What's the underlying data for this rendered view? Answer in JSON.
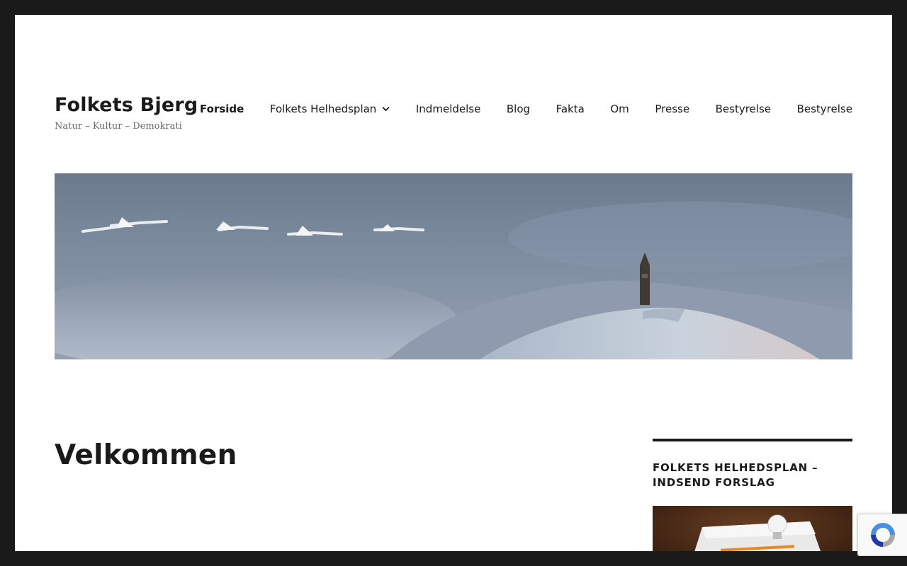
{
  "site": {
    "title": "Folkets Bjerg",
    "description": "Natur – Kultur – Demokrati"
  },
  "nav": {
    "items": [
      {
        "label": "Forside",
        "current": true
      },
      {
        "label": "Folkets Helhedsplan",
        "has_submenu": true
      },
      {
        "label": "Indmeldelse"
      },
      {
        "label": "Blog"
      },
      {
        "label": "Fakta"
      },
      {
        "label": "Om"
      },
      {
        "label": "Presse"
      },
      {
        "label": "Bestyrelse"
      },
      {
        "label": "Bestyrelse"
      }
    ]
  },
  "header_image": {
    "icon": "header-landscape-image",
    "subject": "swans-over-snowy-hill-with-tower"
  },
  "main": {
    "title": "Velkommen"
  },
  "sidebar": {
    "widget": {
      "title": "FOLKETS HELHEDSPLAN – INDSEND FORSLAG",
      "image_icon": "lightbulb-paper-image"
    }
  },
  "recaptcha": {
    "icon": "recaptcha-icon"
  },
  "colors": {
    "frame": "#1a1a1a",
    "page": "#ffffff",
    "text": "#1a1a1a",
    "muted": "#686868"
  }
}
